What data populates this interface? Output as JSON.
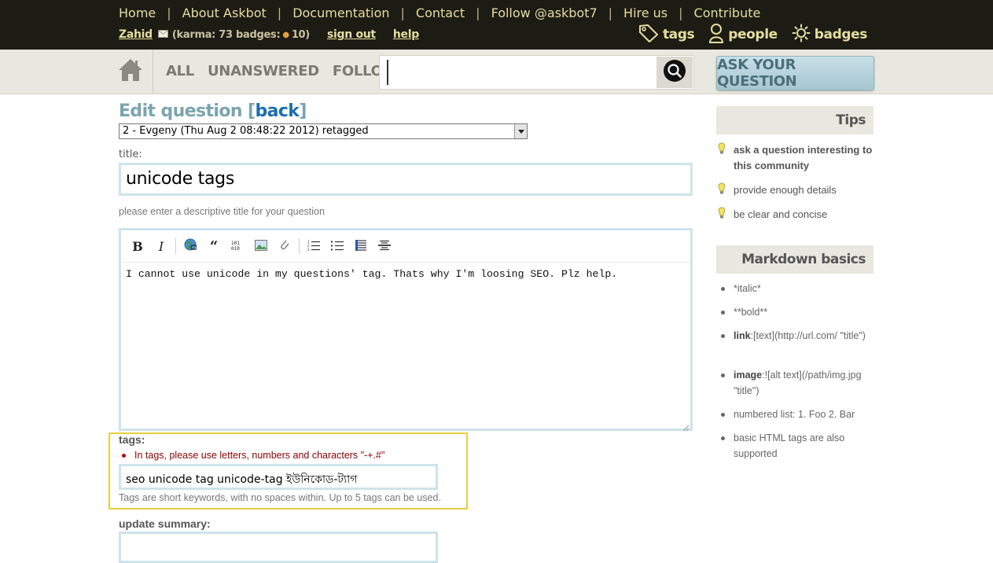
{
  "topnav": {
    "items": [
      "Home",
      "About Askbot",
      "Documentation",
      "Contact",
      "Follow @askbot7",
      "Hire us",
      "Contribute"
    ],
    "separator": "|"
  },
  "user": {
    "name": "Zahid",
    "karma_badges": "(karma: 73 badges:",
    "badge_count": "10)",
    "sign_out": "sign out",
    "help": "help"
  },
  "metanav": {
    "tags": "tags",
    "people": "people",
    "badges": "badges"
  },
  "scope": {
    "all": "ALL",
    "unanswered": "UNANSWERED",
    "followed": "FOLLOWED"
  },
  "search": {
    "value": ""
  },
  "ask_button": "ASK YOUR QUESTION",
  "edit": {
    "title_prefix": "Edit question [",
    "back": "back",
    "title_suffix": "]",
    "revision": "2 - Evgeny (Thu Aug 2 08:48:22 2012) retagged",
    "title_label": "title:",
    "title_value": "unicode tags",
    "title_hint": "please enter a descriptive title for your question",
    "body": "I cannot use unicode in my questions' tag. Thats why I'm loosing SEO. Plz help.",
    "tags_label": "tags:",
    "tags_error": "In tags, please use letters, numbers and characters \"-+.#\"",
    "tags_value": "seo unicode tag unicode-tag ইউনিকোড-ট্যাগ",
    "tags_hint": "Tags are short keywords, with no spaces within. Up to 5 tags can be used.",
    "summary_label": "update summary:"
  },
  "sidebar": {
    "tips_title": "Tips",
    "tips": [
      "ask a question interesting to this community",
      "provide enough details",
      "be clear and concise"
    ],
    "markdown_title": "Markdown basics",
    "markdown": [
      {
        "label": "",
        "text": "*italic*"
      },
      {
        "label": "",
        "text": "**bold**"
      },
      {
        "label": "link",
        "text": ":[text](http://url.com/ \"title\")"
      },
      {
        "label": "image",
        "text": ":![alt text](/path/img.jpg \"title\")"
      },
      {
        "label": "",
        "text": "numbered list: 1. Foo 2. Bar"
      },
      {
        "label": "",
        "text": "basic HTML tags are also supported"
      }
    ]
  },
  "colors": {
    "header_bg": "#1c1b14",
    "header_text": "#e4de9e",
    "accent_blue": "#1a6fb0",
    "input_border": "#cde4ea",
    "error_red": "#8b0000",
    "highlight_border": "#e5cf40"
  }
}
